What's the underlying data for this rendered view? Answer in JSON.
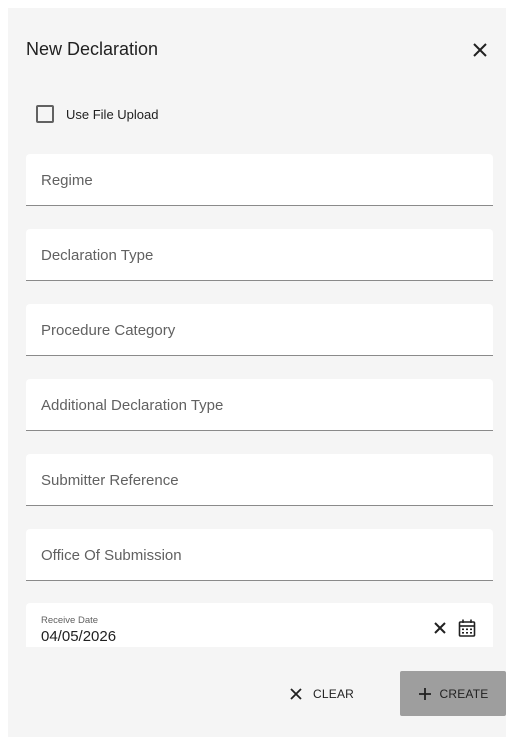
{
  "dialog": {
    "title": "New Declaration",
    "checkbox": {
      "label": "Use File Upload",
      "checked": false
    },
    "fields": [
      {
        "label": "Regime"
      },
      {
        "label": "Declaration Type"
      },
      {
        "label": "Procedure Category"
      },
      {
        "label": "Additional Declaration Type"
      },
      {
        "label": "Submitter Reference"
      },
      {
        "label": "Office Of Submission"
      }
    ],
    "receive_date": {
      "label": "Receive Date",
      "value": "04/05/2026"
    },
    "actions": {
      "clear_label": "CLEAR",
      "create_label": "CREATE"
    }
  },
  "icons": {
    "close": "close-icon",
    "clear": "close-icon",
    "calendar": "calendar-icon",
    "add": "plus-icon"
  },
  "colors": {
    "dialog_bg": "#f5f5f5",
    "field_bg": "#ffffff",
    "create_button_bg": "#9e9e9e",
    "text": "#212121",
    "placeholder": "#616161"
  }
}
